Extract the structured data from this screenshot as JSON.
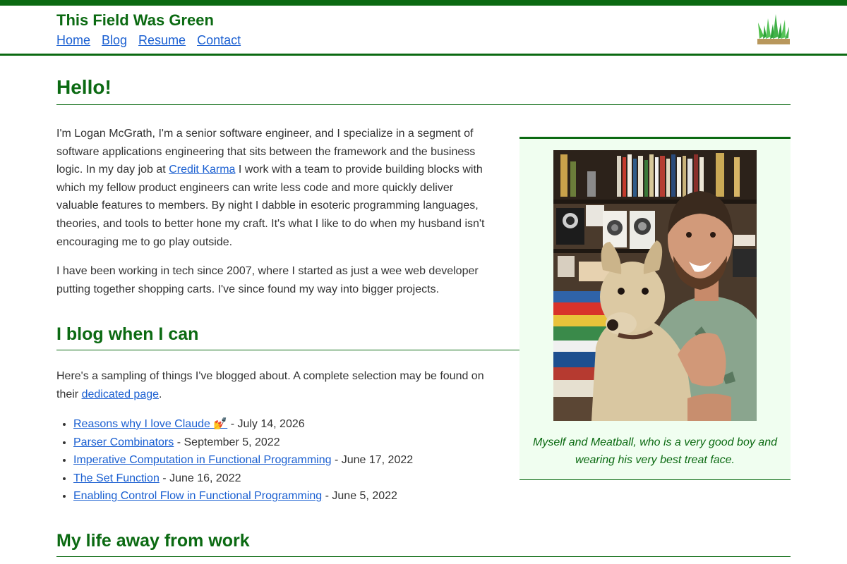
{
  "site": {
    "title": "This Field Was Green"
  },
  "nav": {
    "items": [
      "Home",
      "Blog",
      "Resume",
      "Contact"
    ]
  },
  "intro": {
    "heading": "Hello!",
    "p1_a": "I'm Logan McGrath, I'm a senior software engineer, and I specialize in a segment of software applications engineering that sits between the framework and the business logic. In my day job at ",
    "p1_link": "Credit Karma",
    "p1_b": " I work with a team to provide building blocks with which my fellow product engineers can write less code and more quickly deliver valuable features to members. By night I dabble in esoteric programming languages, theories, and tools to better hone my craft. It's what I like to do when my husband isn't encouraging me to go play outside.",
    "p2": "I have been working in tech since 2007, where I started as just a wee web developer putting together shopping carts. I've since found my way into bigger projects."
  },
  "blog": {
    "heading": "I blog when I can",
    "intro_a": "Here's a sampling of things I've blogged about. A complete selection may be found on their ",
    "intro_link": "dedicated page",
    "intro_b": ".",
    "posts": [
      {
        "title": "Reasons why I love Claude 💅",
        "date": " - July 14, 2026"
      },
      {
        "title": "Parser Combinators",
        "date": " - September 5, 2022"
      },
      {
        "title": "Imperative Computation in Functional Programming",
        "date": " - June 17, 2022"
      },
      {
        "title": "The Set Function",
        "date": " - June 16, 2022"
      },
      {
        "title": "Enabling Control Flow in Functional Programming",
        "date": " - June 5, 2022"
      }
    ]
  },
  "life": {
    "heading": "My life away from work"
  },
  "aside": {
    "caption": "Myself and Meatball, who is a very good boy and wearing his very best treat face."
  },
  "colors": {
    "brand_green": "#0b6a12",
    "link_blue": "#1a5fd1",
    "aside_bg": "#f0fef0"
  }
}
